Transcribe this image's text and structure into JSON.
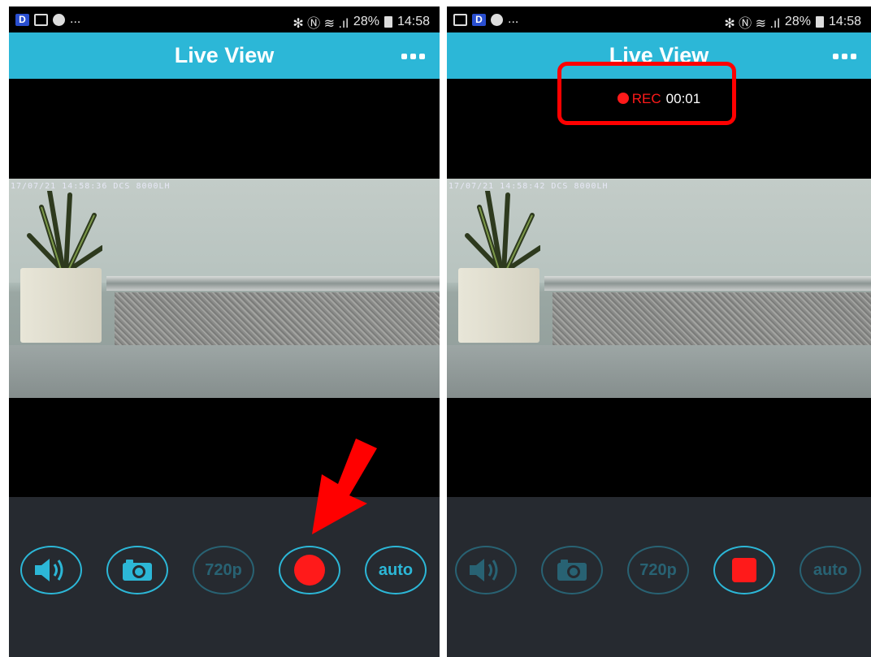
{
  "left_screen": {
    "status": {
      "icons_left": [
        "d-app-icon",
        "image-icon",
        "message-icon"
      ],
      "overflow": "...",
      "icons_right": "✻ Ⓝ ≋ .ıl",
      "battery": "28%",
      "time": "14:58"
    },
    "app_bar": {
      "title": "Live View",
      "menu_icon": "more-icon"
    },
    "video": {
      "osd": "17/07/21 14:58:36 DCS 8000LH"
    },
    "controls": [
      {
        "name": "audio",
        "icon": "speaker-icon",
        "enabled": true
      },
      {
        "name": "snapshot",
        "icon": "camera-icon",
        "enabled": true
      },
      {
        "name": "resolution",
        "label": "720p",
        "enabled": false
      },
      {
        "name": "record",
        "icon": "record-icon",
        "enabled": true
      },
      {
        "name": "auto",
        "label": "auto",
        "enabled": true
      }
    ]
  },
  "right_screen": {
    "status": {
      "icons_left": [
        "image-icon",
        "d-app-icon",
        "message-icon"
      ],
      "overflow": "...",
      "icons_right": "✻ Ⓝ ≋ .ıl",
      "battery": "28%",
      "time": "14:58"
    },
    "app_bar": {
      "title": "Live View",
      "menu_icon": "more-icon"
    },
    "recording": {
      "label": "REC",
      "elapsed": "00:01"
    },
    "video": {
      "osd": "17/07/21 14:58:42 DCS 8000LH"
    },
    "controls": [
      {
        "name": "audio",
        "icon": "speaker-icon",
        "enabled": false
      },
      {
        "name": "snapshot",
        "icon": "camera-icon",
        "enabled": false
      },
      {
        "name": "resolution",
        "label": "720p",
        "enabled": false
      },
      {
        "name": "stop",
        "icon": "stop-icon",
        "enabled": true
      },
      {
        "name": "auto",
        "label": "auto",
        "enabled": false
      }
    ]
  },
  "annotations": {
    "arrow_color": "#ff0000",
    "highlight_color": "#ff0000"
  },
  "colors": {
    "accent": "#2cb7d7",
    "record": "#ff1a1a",
    "control_bg": "#262a30"
  }
}
